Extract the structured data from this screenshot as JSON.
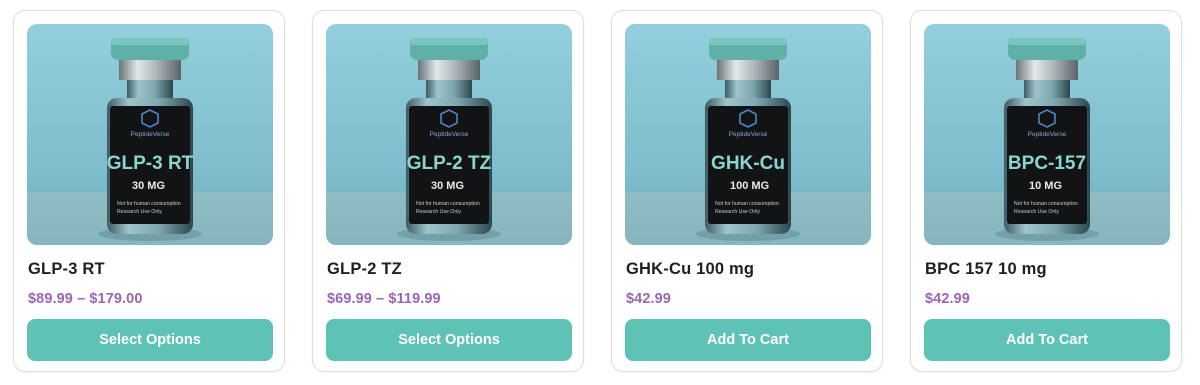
{
  "products": [
    {
      "name": "GLP-3 RT",
      "price": "$89.99 – $179.00",
      "button": "Select Options",
      "label": {
        "brand": "PeptideVerse",
        "name": "GLP-3 RT",
        "dose": "30 MG",
        "notice_line1": "Not for human consumption",
        "notice_line2": "Research Use Only"
      }
    },
    {
      "name": "GLP-2 TZ",
      "price": "$69.99 – $119.99",
      "button": "Select Options",
      "label": {
        "brand": "PeptideVerse",
        "name": "GLP-2 TZ",
        "dose": "30 MG",
        "notice_line1": "Not for human consumption",
        "notice_line2": "Research Use Only"
      }
    },
    {
      "name": "GHK-Cu 100 mg",
      "price": "$42.99",
      "button": "Add To Cart",
      "label": {
        "brand": "PeptideVerse",
        "name": "GHK-Cu",
        "dose": "100 MG",
        "notice_line1": "Not for human consumption",
        "notice_line2": "Research Use Only"
      }
    },
    {
      "name": "BPC 157 10 mg",
      "price": "$42.99",
      "button": "Add To Cart",
      "label": {
        "brand": "PeptideVerse",
        "name": "BPC-157",
        "dose": "10 MG",
        "notice_line1": "Not for human consumption",
        "notice_line2": "Research Use Only"
      }
    }
  ],
  "colors": {
    "button_bg": "#5ec2b4",
    "price": "#9a66b6",
    "title": "#1d1f23",
    "photo_bg": "#8fcad8",
    "vial_cap": "#5fb0a7",
    "vial_label": "#111315"
  }
}
